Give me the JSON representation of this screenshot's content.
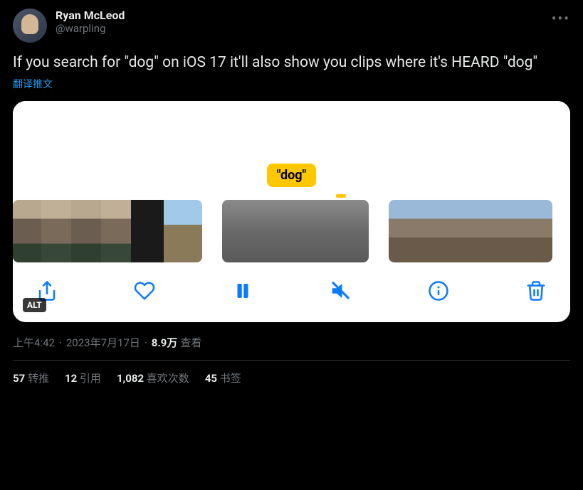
{
  "author": {
    "display_name": "Ryan McLeod",
    "handle": "@warpling"
  },
  "more_label": "•••",
  "body": "If you search for \"dog\" on iOS 17 it'll also show you clips where it's HEARD \"dog\"",
  "translate": "翻译推文",
  "media": {
    "bubble": "\"dog\"",
    "alt_badge": "ALT",
    "icons": {
      "share": "share-icon",
      "heart": "heart-icon",
      "pause": "pause-icon",
      "mute": "mute-icon",
      "info": "info-icon",
      "trash": "trash-icon"
    }
  },
  "meta": {
    "time": "上午4:42",
    "sep1": "·",
    "date": "2023年7月17日",
    "sep2": "·",
    "views_num": "8.9万",
    "views_label": "查看"
  },
  "stats": {
    "retweets_num": "57",
    "retweets_label": "转推",
    "quotes_num": "12",
    "quotes_label": "引用",
    "likes_num": "1,082",
    "likes_label": "喜欢次数",
    "bookmarks_num": "45",
    "bookmarks_label": "书签"
  }
}
